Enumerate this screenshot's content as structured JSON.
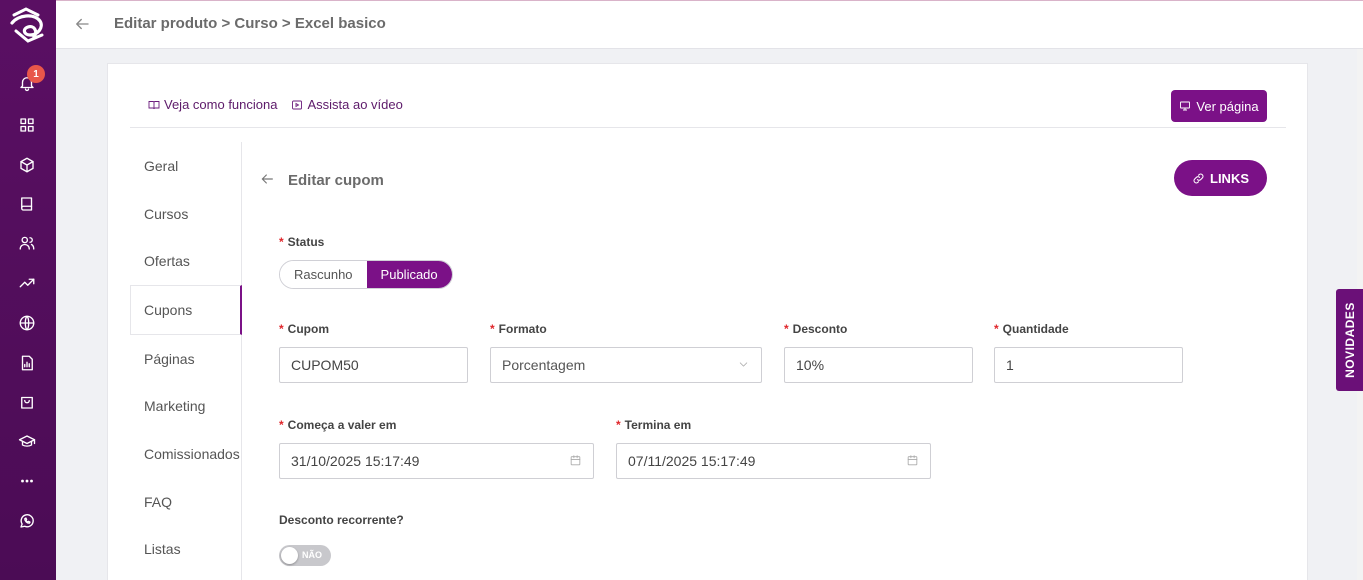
{
  "header": {
    "breadcrumb": "Editar produto > Curso > Excel basico"
  },
  "nav": {
    "notification_count": "1",
    "icons": [
      "bell-icon",
      "dashboard-icon",
      "box-icon",
      "book-icon",
      "users-icon",
      "trending-icon",
      "globe-icon",
      "report-icon",
      "shopping-bag-icon",
      "graduation-cap-icon",
      "more-icon",
      "whatsapp-icon"
    ]
  },
  "help": {
    "how_it_works": "Veja como funciona",
    "watch_video": "Assista ao vídeo"
  },
  "view_page_label": "Ver página",
  "subnav": {
    "items": [
      "Geral",
      "Cursos",
      "Ofertas",
      "Cupons",
      "Páginas",
      "Marketing",
      "Comissionados",
      "FAQ",
      "Listas"
    ],
    "active": "Cupons"
  },
  "form": {
    "title": "Editar cupom",
    "links_label": "LINKS",
    "status_label": "Status",
    "status_options": [
      "Rascunho",
      "Publicado"
    ],
    "status_selected": "Publicado",
    "cupom_label": "Cupom",
    "cupom_value": "CUPOM50",
    "formato_label": "Formato",
    "formato_value": "Porcentagem",
    "desconto_label": "Desconto",
    "desconto_value": "10%",
    "quantidade_label": "Quantidade",
    "quantidade_value": "1",
    "start_label": "Começa a valer em",
    "start_value": "31/10/2025 15:17:49",
    "end_label": "Termina em",
    "end_value": "07/11/2025 15:17:49",
    "recurrent_label": "Desconto recorrente?",
    "recurrent_toggle_text": "NÃO"
  },
  "side_tab": "NOVIDADES",
  "colors": {
    "brand": "#7b1187",
    "nav_bg": "#5a0f63",
    "required": "#e0262b"
  }
}
